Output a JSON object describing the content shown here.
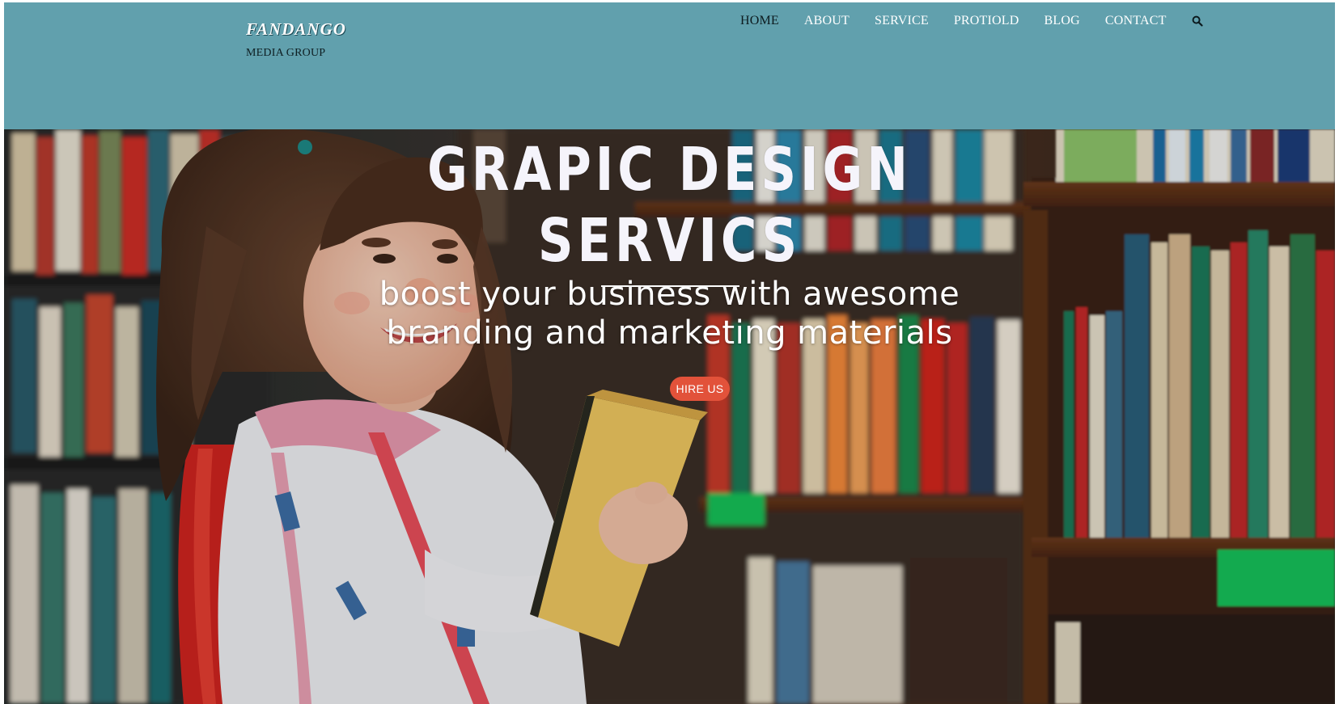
{
  "brand": {
    "name": "FANDANGO",
    "tagline": "MEDIA GROUP"
  },
  "nav": {
    "items": [
      {
        "label": "HOME",
        "active": true
      },
      {
        "label": "ABOUT",
        "active": false
      },
      {
        "label": "SERVICE",
        "active": false
      },
      {
        "label": "PROTIOLD",
        "active": false
      },
      {
        "label": "BLOG",
        "active": false
      },
      {
        "label": "CONTACT",
        "active": false
      }
    ],
    "search_icon": "search-icon"
  },
  "hero": {
    "title_line1": "GRAPIC DESIGN",
    "title_line2": "SERVICS",
    "subtitle_line1": "boost your business with awesome",
    "subtitle_line2": "branding and marketing materials",
    "cta_label": "HIRE US"
  },
  "colors": {
    "header_bg": "#61a0ad",
    "cta_bg": "#e2523a",
    "nav_active": "#0c1a1e",
    "nav_text": "#ffffff"
  }
}
